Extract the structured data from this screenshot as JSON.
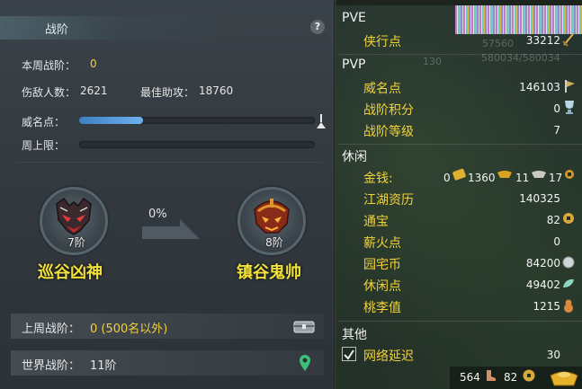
{
  "left_panel": {
    "title": "战阶",
    "help": "?",
    "weekly_rank_label": "本周战阶：",
    "weekly_rank_value": "0",
    "kills_label": "伤敌人数：",
    "kills_value": "2621",
    "best_assist_label": "最佳助攻：",
    "best_assist_value": "18760",
    "prestige_label": "威名点：",
    "prestige_progress": 0.27,
    "weekly_cap_label": "周上限：",
    "weekly_cap_progress": 0,
    "current_rank": {
      "level": "7阶",
      "name": "巡谷凶神"
    },
    "progress_percent": "0%",
    "next_rank": {
      "level": "8阶",
      "name": "镇谷鬼帅"
    },
    "last_week_label": "上周战阶：",
    "last_week_value": "0 (500名以外)",
    "world_rank_label": "世界战阶：",
    "world_rank_value": "11阶"
  },
  "right_panel": {
    "pve": {
      "header": "PVE",
      "items": [
        {
          "label": "侠行点",
          "value": "33212"
        }
      ]
    },
    "pvp": {
      "header": "PVP",
      "items": [
        {
          "label": "威名点",
          "value": "146103"
        },
        {
          "label": "战阶积分",
          "value": "0"
        },
        {
          "label": "战阶等级",
          "value": "7"
        }
      ]
    },
    "leisure": {
      "header": "休闲",
      "money_label": "金钱:",
      "money_values": [
        "0",
        "1360",
        "11",
        "17"
      ],
      "items": [
        {
          "label": "江湖资历",
          "value": "140325"
        },
        {
          "label": "通宝",
          "value": "82"
        },
        {
          "label": "薪火点",
          "value": "0"
        },
        {
          "label": "园宅币",
          "value": "84200"
        },
        {
          "label": "休闲点",
          "value": "49402"
        },
        {
          "label": "桃李值",
          "value": "1215"
        }
      ]
    },
    "other": {
      "header": "其他",
      "network_label": "网络延迟",
      "network_value": "30",
      "network_checked": true
    },
    "bottom_bar": {
      "value1": "564",
      "value2": "82"
    },
    "background_text": {
      "a": "57560",
      "b": "580034/580034",
      "c": "130"
    }
  },
  "colors": {
    "accent_gold": "#f2d23a",
    "rank_name": "#f2e23a",
    "progress_blue": "#5aa0e0"
  }
}
